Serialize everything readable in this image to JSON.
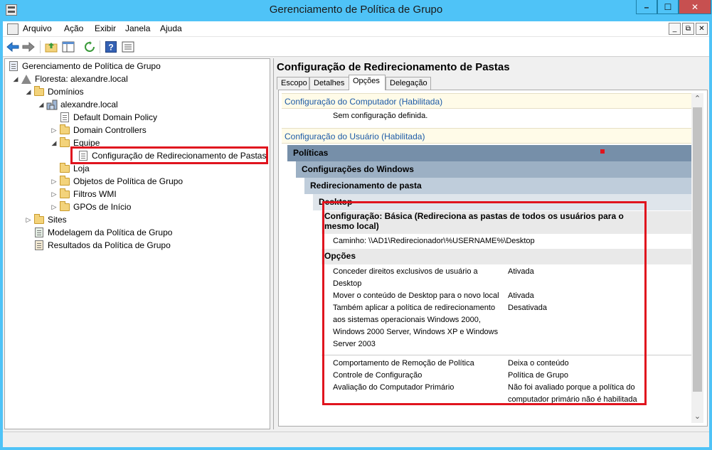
{
  "window": {
    "title": "Gerenciamento de Política de Grupo"
  },
  "menubar": {
    "items": [
      "Arquivo",
      "Ação",
      "Exibir",
      "Janela",
      "Ajuda"
    ]
  },
  "toolbar": {
    "icons": [
      "back-arrow",
      "forward-arrow",
      "up-folder",
      "show-hide-tree",
      "refresh",
      "help",
      "properties"
    ]
  },
  "tree": {
    "items": [
      {
        "label": "Gerenciamento de Política de Grupo",
        "icon": "gpm-root"
      },
      {
        "label": "Floresta: alexandre.local",
        "icon": "forest"
      },
      {
        "label": "Domínios",
        "icon": "folder"
      },
      {
        "label": "alexandre.local",
        "icon": "domain"
      },
      {
        "label": "Default Domain Policy",
        "icon": "gpo-link"
      },
      {
        "label": "Domain Controllers",
        "icon": "folder"
      },
      {
        "label": "Equipe",
        "icon": "folder"
      },
      {
        "label": "Configuração de Redirecionamento de Pastas",
        "icon": "gpo-link"
      },
      {
        "label": "Loja",
        "icon": "folder"
      },
      {
        "label": "Objetos de Política de Grupo",
        "icon": "folder"
      },
      {
        "label": "Filtros WMI",
        "icon": "folder"
      },
      {
        "label": "GPOs de Início",
        "icon": "folder"
      },
      {
        "label": "Sites",
        "icon": "sites"
      },
      {
        "label": "Modelagem da Política de Grupo",
        "icon": "modeling"
      },
      {
        "label": "Resultados da Política de Grupo",
        "icon": "results"
      }
    ]
  },
  "right": {
    "title": "Configuração de Redirecionamento de Pastas",
    "tabs": [
      "Escopo",
      "Detalhes",
      "Opções",
      "Delegação"
    ],
    "active_tab": "Opções",
    "report": {
      "computer_header": "Configuração do Computador (Habilitada)",
      "computer_none": "Sem configuração definida.",
      "user_header": "Configuração do Usuário (Habilitada)",
      "policies": "Políticas",
      "windows_settings": "Configurações do Windows",
      "folder_redirection": "Redirecionamento de pasta",
      "desktop": "Desktop",
      "config_line1": "Configuração: Básica (Redireciona as pastas de todos os usuários para o",
      "config_line2": "mesmo local)",
      "path": "Caminho: \\\\AD1\\Redirecionador\\%USERNAME%\\Desktop",
      "options_header": "Opções",
      "options": [
        {
          "name_lines": [
            "Conceder direitos exclusivos de usuário a",
            "Desktop"
          ],
          "value_lines": [
            "Ativada"
          ]
        },
        {
          "name_lines": [
            "Mover o conteúdo de Desktop para o novo local"
          ],
          "value_lines": [
            "Ativada"
          ]
        },
        {
          "name_lines": [
            "Também aplicar a política de redirecionamento",
            "aos sistemas operacionais Windows 2000,",
            "Windows 2000 Server, Windows XP e Windows",
            "Server 2003"
          ],
          "value_lines": [
            "Desativada"
          ]
        }
      ],
      "extra": [
        {
          "name": "Comportamento de Remoção de Política",
          "value_lines": [
            "Deixa o conteúdo"
          ]
        },
        {
          "name": "Controle de Configuração",
          "value_lines": [
            "Política de Grupo"
          ]
        },
        {
          "name": "Avaliação do Computador Primário",
          "value_lines": [
            "Não foi avaliado porque a política do",
            "computador primário não é habilitada"
          ]
        }
      ]
    }
  },
  "colors": {
    "highlight": "#e0141e",
    "header_link": "#1c5aa6",
    "title_bar": "#4fc3f7"
  }
}
